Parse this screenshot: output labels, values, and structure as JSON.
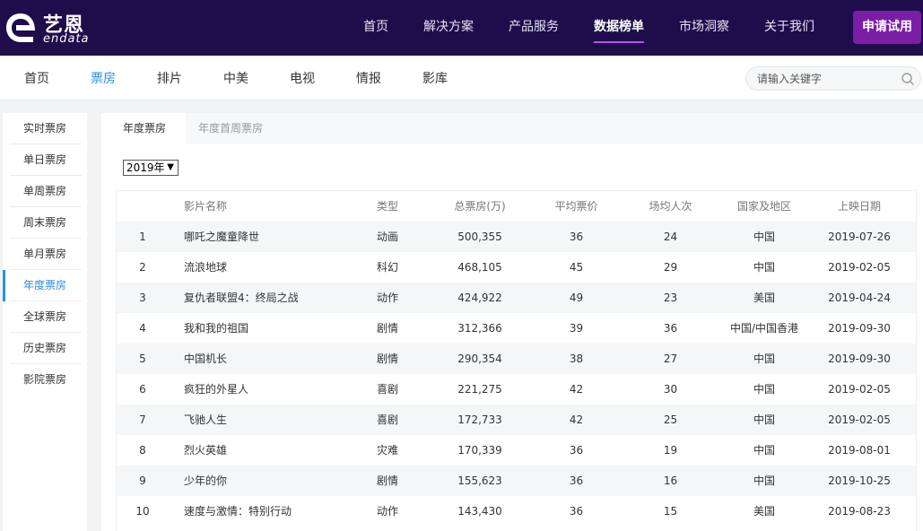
{
  "header": {
    "logo_cn": "艺恩",
    "logo_en": "endata",
    "nav": [
      "首页",
      "解决方案",
      "产品服务",
      "数据榜单",
      "市场洞察",
      "关于我们"
    ],
    "active_nav_index": 3,
    "trial_button": "申请试用"
  },
  "subnav": {
    "items": [
      "首页",
      "票房",
      "排片",
      "中美",
      "电视",
      "情报",
      "影库"
    ],
    "active_index": 1,
    "search_placeholder": "请输入关键字"
  },
  "sidebar": {
    "items": [
      "实时票房",
      "单日票房",
      "单周票房",
      "周末票房",
      "单月票房",
      "年度票房",
      "全球票房",
      "历史票房",
      "影院票房"
    ],
    "active_index": 5
  },
  "main": {
    "tabs": [
      "年度票房",
      "年度首周票房"
    ],
    "active_tab_index": 0,
    "year_select": "2019年",
    "table": {
      "headers": [
        "",
        "影片名称",
        "类型",
        "总票房(万)",
        "平均票价",
        "场均人次",
        "国家及地区",
        "上映日期"
      ],
      "rows": [
        [
          "1",
          "哪吒之魔童降世",
          "动画",
          "500,355",
          "36",
          "24",
          "中国",
          "2019-07-26"
        ],
        [
          "2",
          "流浪地球",
          "科幻",
          "468,105",
          "45",
          "29",
          "中国",
          "2019-02-05"
        ],
        [
          "3",
          "复仇者联盟4：终局之战",
          "动作",
          "424,922",
          "49",
          "23",
          "美国",
          "2019-04-24"
        ],
        [
          "4",
          "我和我的祖国",
          "剧情",
          "312,366",
          "39",
          "36",
          "中国/中国香港",
          "2019-09-30"
        ],
        [
          "5",
          "中国机长",
          "剧情",
          "290,354",
          "38",
          "27",
          "中国",
          "2019-09-30"
        ],
        [
          "6",
          "疯狂的外星人",
          "喜剧",
          "221,275",
          "42",
          "30",
          "中国",
          "2019-02-05"
        ],
        [
          "7",
          "飞驰人生",
          "喜剧",
          "172,733",
          "42",
          "25",
          "中国",
          "2019-02-05"
        ],
        [
          "8",
          "烈火英雄",
          "灾难",
          "170,339",
          "36",
          "19",
          "中国",
          "2019-08-01"
        ],
        [
          "9",
          "少年的你",
          "剧情",
          "155,623",
          "36",
          "16",
          "中国",
          "2019-10-25"
        ],
        [
          "10",
          "速度与激情：特别行动",
          "动作",
          "143,430",
          "36",
          "15",
          "美国",
          "2019-08-23"
        ]
      ]
    }
  },
  "colors": {
    "header_bg": "#1f0c4b",
    "accent": "#2d8ee0",
    "trial_button": "#7a1ea8"
  }
}
